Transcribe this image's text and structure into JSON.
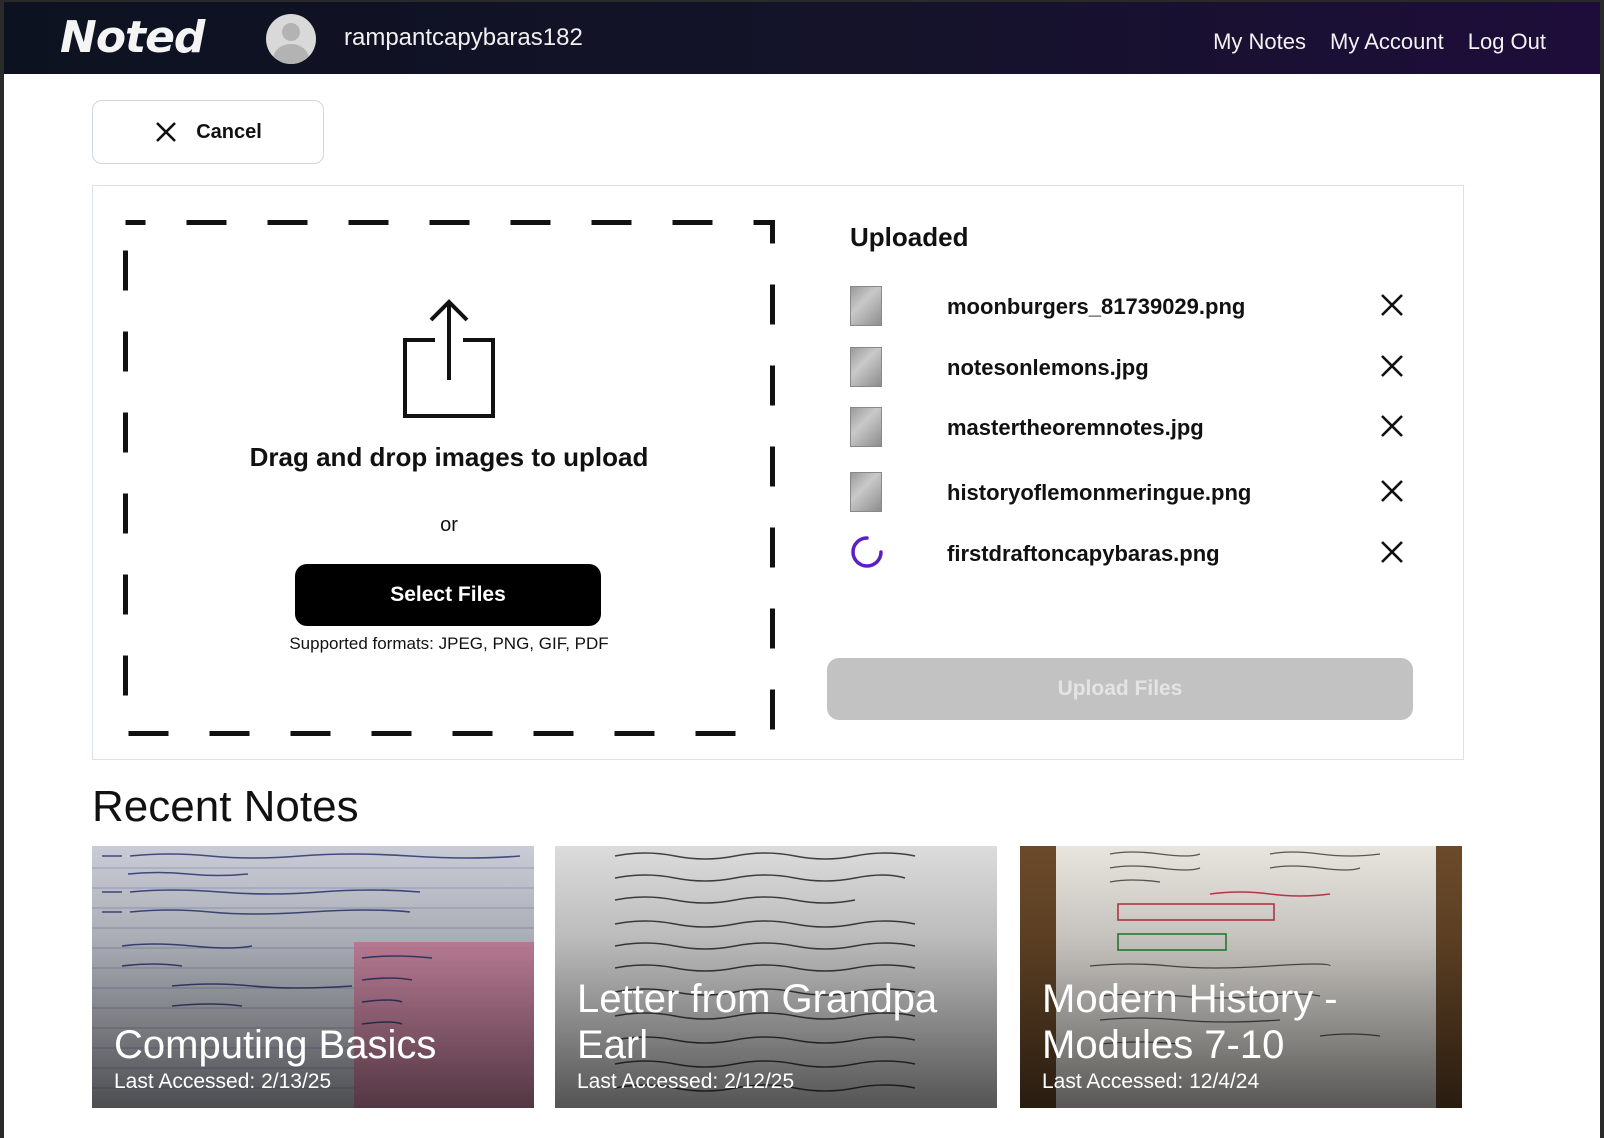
{
  "header": {
    "logo": "Noted",
    "username": "rampantcapybaras182",
    "nav": [
      "My Notes",
      "My Account",
      "Log Out"
    ]
  },
  "cancel": {
    "label": "Cancel"
  },
  "dropzone": {
    "title": "Drag and drop images to upload",
    "or": "or",
    "select_label": "Select Files",
    "formats": "Supported formats: JPEG, PNG, GIF, PDF"
  },
  "uploaded": {
    "title": "Uploaded",
    "files": [
      {
        "name": "moonburgers_81739029.png",
        "status": "uploaded"
      },
      {
        "name": "notesonlemons.jpg",
        "status": "uploaded"
      },
      {
        "name": "mastertheoremnotes.jpg",
        "status": "uploaded"
      },
      {
        "name": "historyoflemonmeringue.png",
        "status": "uploaded"
      },
      {
        "name": "firstdraftoncapybaras.png",
        "status": "loading"
      }
    ],
    "upload_label": "Upload Files"
  },
  "recent": {
    "title": "Recent Notes",
    "notes": [
      {
        "title": "Computing Basics",
        "accessed": "Last Accessed: 2/13/25"
      },
      {
        "title": "Letter from Grandpa Earl",
        "accessed": "Last Accessed: 2/12/25"
      },
      {
        "title": "Modern History - Modules 7-10",
        "accessed": "Last Accessed: 12/4/24"
      }
    ]
  },
  "colors": {
    "header_start": "#0d1220",
    "header_end": "#1e0d3a",
    "spinner": "#5b1fc4",
    "disabled_button": "#c2c2c2"
  }
}
